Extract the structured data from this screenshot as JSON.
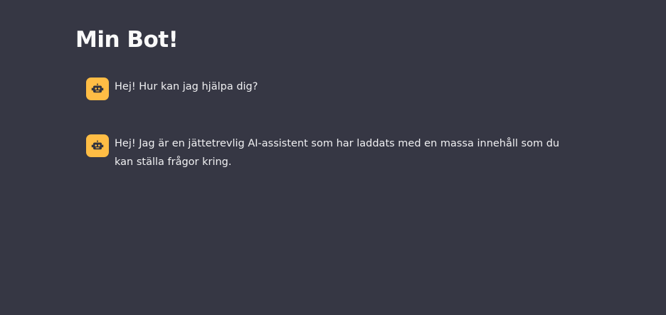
{
  "page": {
    "title": "Min Bot!"
  },
  "messages": [
    {
      "role": "assistant",
      "avatar_icon": "robot-icon",
      "text": "Hej! Hur kan jag hjälpa dig?"
    },
    {
      "role": "assistant",
      "avatar_icon": "robot-icon",
      "text": "Hej! Jag är en jättetrevlig AI-assistent som har laddats med en massa innehåll som du kan ställa frågor kring."
    }
  ],
  "colors": {
    "background": "#363744",
    "avatar_bg": "#ffbd45",
    "text": "#f0f0f2"
  }
}
